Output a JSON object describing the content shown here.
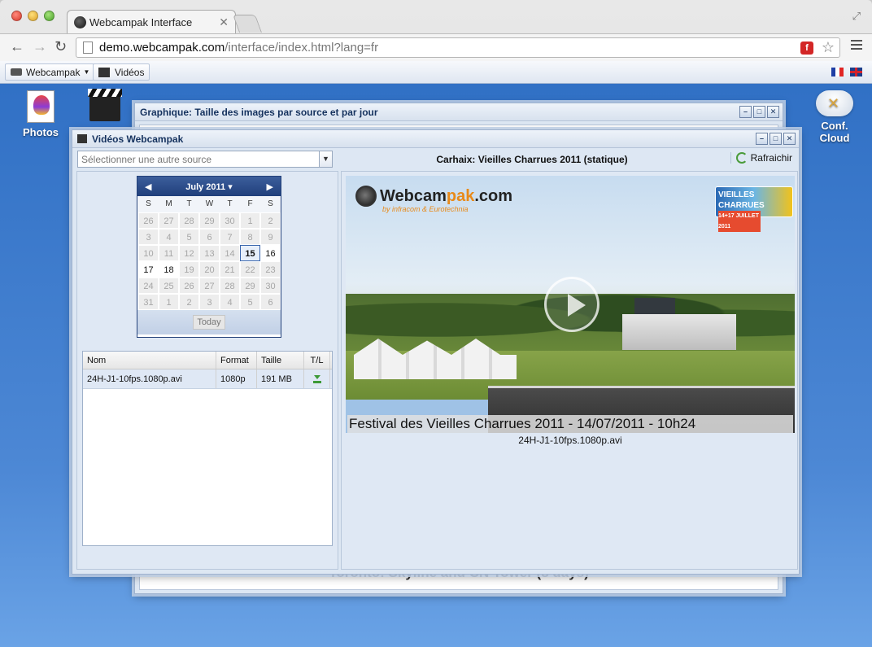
{
  "browser": {
    "tab_title": "Webcampak Interface",
    "url_host": "demo.webcampak.com",
    "url_path": "/interface/index.html?lang=fr"
  },
  "app_bar": {
    "menu_label": "Webcampak",
    "videos_label": "Vidéos"
  },
  "desktop": {
    "photos_label": "Photos",
    "cloud_label": "Conf. Cloud"
  },
  "bg_window": {
    "title": "Graphique: Taille des images par source et par jour",
    "caption": "Toronto: Skyline and CN Tower (8 days)"
  },
  "videos_window": {
    "title": "Vidéos Webcampak",
    "source_placeholder": "Sélectionner une autre source",
    "stream_title": "Carhaix: Vieilles Charrues 2011 (statique)",
    "refresh_label": "Rafraichir"
  },
  "calendar": {
    "month_label": "July 2011",
    "weekdays": [
      "S",
      "M",
      "T",
      "W",
      "T",
      "F",
      "S"
    ],
    "weeks": [
      [
        "26",
        "27",
        "28",
        "29",
        "30",
        "1",
        "2"
      ],
      [
        "3",
        "4",
        "5",
        "6",
        "7",
        "8",
        "9"
      ],
      [
        "10",
        "11",
        "12",
        "13",
        "14",
        "15",
        "16"
      ],
      [
        "17",
        "18",
        "19",
        "20",
        "21",
        "22",
        "23"
      ],
      [
        "24",
        "25",
        "26",
        "27",
        "28",
        "29",
        "30"
      ],
      [
        "31",
        "1",
        "2",
        "3",
        "4",
        "5",
        "6"
      ]
    ],
    "available_days": [
      "15",
      "16",
      "17",
      "18"
    ],
    "selected_day": "15",
    "today_label": "Today"
  },
  "file_grid": {
    "columns": [
      "Nom",
      "Format",
      "Taille",
      "T/L"
    ],
    "rows": [
      {
        "name": "24H-J1-10fps.1080p.avi",
        "format": "1080p",
        "size": "191 MB"
      }
    ]
  },
  "video": {
    "logo_main": "Webcam",
    "logo_accent": "pak",
    "logo_suffix": ".com",
    "logo_sub": "by infracom & Eurotechnia",
    "festival_badge": "VIEILLES CHARRUES",
    "festival_dates": "14+17 JUILLET 2011",
    "overlay_caption": "Festival des Vieilles Charrues 2011 - 14/07/2011 - 10h24",
    "file_label": "24H-J1-10fps.1080p.avi"
  }
}
